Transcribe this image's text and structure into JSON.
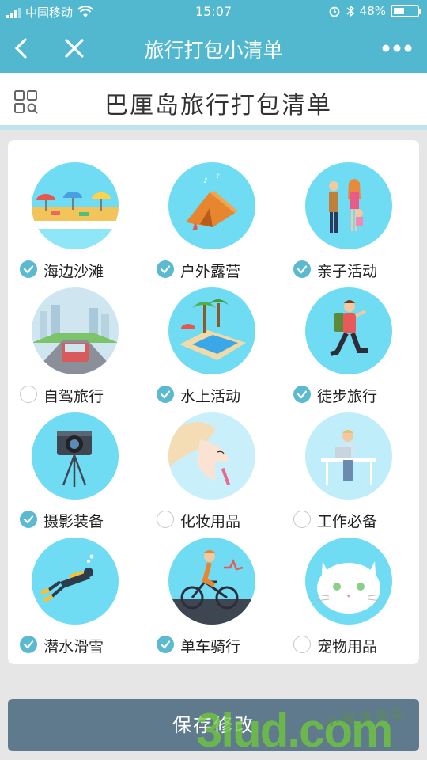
{
  "status": {
    "carrier": "中国移动",
    "time": "15:07",
    "battery": "48%",
    "battery_level": 0.48
  },
  "nav": {
    "title": "旅行打包小清单"
  },
  "header": {
    "title": "巴厘岛旅行打包清单"
  },
  "items": [
    {
      "label": "海边沙滩",
      "checked": true,
      "icon": "beach-icon"
    },
    {
      "label": "户外露营",
      "checked": true,
      "icon": "tent-icon"
    },
    {
      "label": "亲子活动",
      "checked": true,
      "icon": "family-icon"
    },
    {
      "label": "自驾旅行",
      "checked": false,
      "icon": "car-icon"
    },
    {
      "label": "水上活动",
      "checked": true,
      "icon": "pool-icon"
    },
    {
      "label": "徒步旅行",
      "checked": true,
      "icon": "hiker-icon"
    },
    {
      "label": "摄影装备",
      "checked": true,
      "icon": "camera-icon"
    },
    {
      "label": "化妆用品",
      "checked": false,
      "icon": "makeup-icon"
    },
    {
      "label": "工作必备",
      "checked": false,
      "icon": "work-desk-icon"
    },
    {
      "label": "潜水滑雪",
      "checked": true,
      "icon": "diver-icon"
    },
    {
      "label": "单车骑行",
      "checked": true,
      "icon": "cyclist-icon"
    },
    {
      "label": "宠物用品",
      "checked": false,
      "icon": "cat-icon"
    }
  ],
  "save_button": "保存修改",
  "watermark": {
    "brand": "3lud.com",
    "tag": "小程序商店"
  },
  "colors": {
    "primary": "#51b8cf",
    "check": "#5bbad0",
    "circle": "#6fdcf3",
    "button": "#5f7a8c"
  }
}
